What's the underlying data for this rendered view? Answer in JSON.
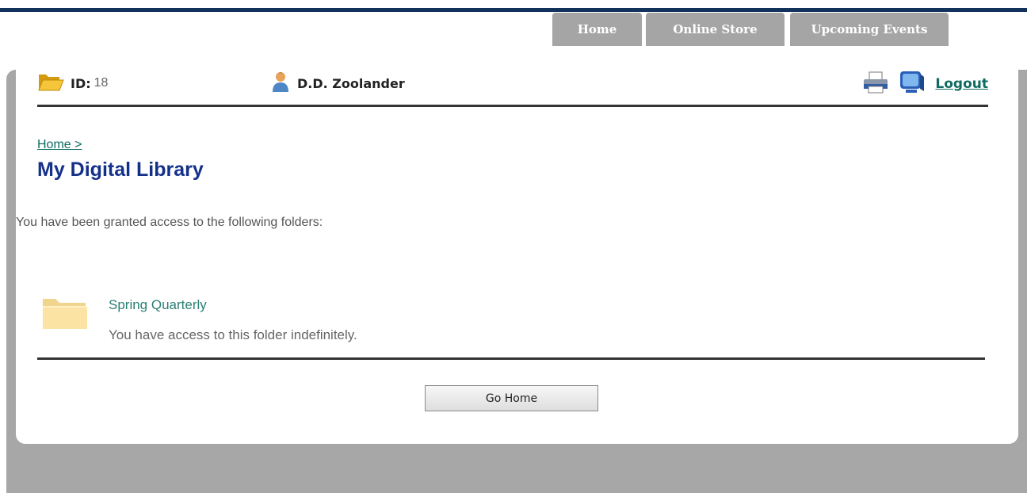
{
  "nav": {
    "tabs": [
      {
        "label": "Home"
      },
      {
        "label": "Online Store"
      },
      {
        "label": "Upcoming Events"
      }
    ]
  },
  "header": {
    "id_label": "ID:",
    "id_value": "18",
    "user_name": "D.D. Zoolander",
    "logout_label": "Logout"
  },
  "main": {
    "breadcrumb": "Home >",
    "title": "My Digital Library",
    "intro": "You have been granted access to the following folders:",
    "folders": [
      {
        "name": "Spring Quarterly",
        "access": "You have access to this folder indefinitely."
      }
    ],
    "go_home_label": "Go Home"
  },
  "colors": {
    "top_bar": "#13325b",
    "tab_bg": "#a5a5a5",
    "title": "#14318a",
    "link": "#0f6b62",
    "folder_link": "#2a7f74"
  },
  "icons": {
    "id": "open-folder-icon",
    "user": "user-icon",
    "print": "printer-icon",
    "computer": "computer-icon",
    "folder": "folder-icon"
  }
}
